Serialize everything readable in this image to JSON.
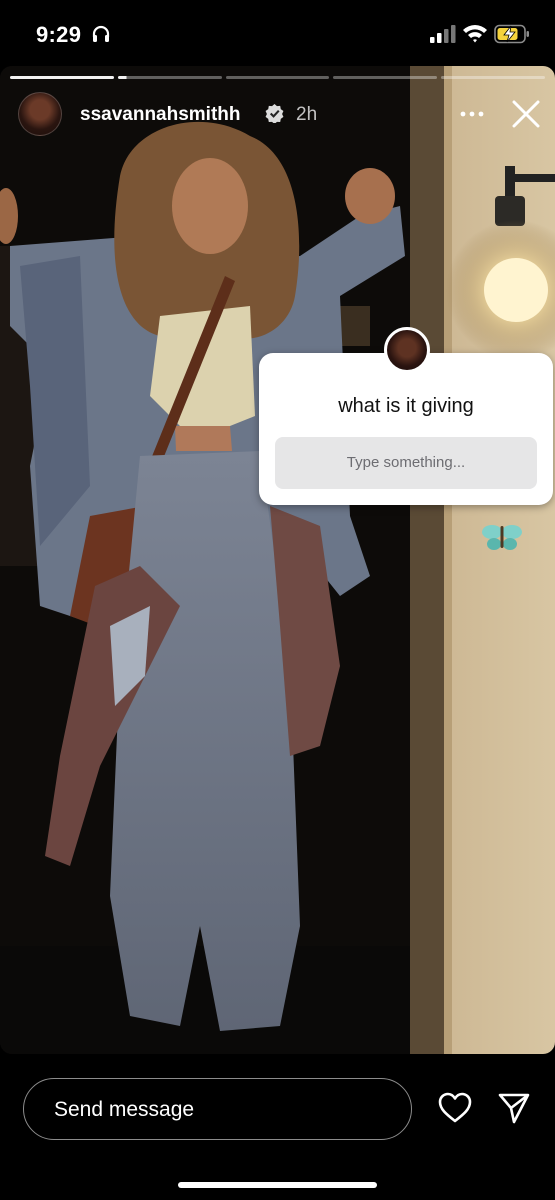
{
  "status_bar": {
    "time": "9:29",
    "headphones_icon": "headphones-icon",
    "signal_icon": "cellular-signal-icon",
    "wifi_icon": "wifi-icon",
    "battery_icon": "battery-charging-icon"
  },
  "story": {
    "segments_total": 5,
    "segments_done": 1,
    "current_segment_progress": 0.08,
    "username": "ssavannahsmithh",
    "verified": true,
    "age": "2h",
    "more_icon": "more-horizontal-icon",
    "close_icon": "close-icon"
  },
  "question_sticker": {
    "question": "what is it giving",
    "placeholder": "Type something..."
  },
  "bottom_bar": {
    "message_placeholder": "Send message",
    "like_icon": "heart-icon",
    "share_icon": "send-icon"
  },
  "colors": {
    "sticker_bg": "#ffffff",
    "input_bg": "#e6e6e7",
    "battery_fill": "#f5d33c"
  }
}
